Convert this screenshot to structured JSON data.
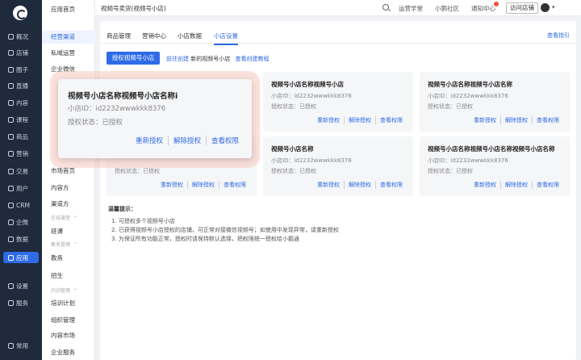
{
  "rail": {
    "items": [
      {
        "label": "概况"
      },
      {
        "label": "店铺"
      },
      {
        "label": "圈子"
      },
      {
        "label": "直播"
      },
      {
        "label": "内容"
      },
      {
        "label": "课程"
      },
      {
        "label": "商品"
      },
      {
        "label": "营销"
      },
      {
        "label": "交易"
      },
      {
        "label": "用户"
      },
      {
        "label": "CRM"
      },
      {
        "label": "企微"
      },
      {
        "label": "数据"
      },
      {
        "label": "应用"
      },
      {
        "label": "设置"
      },
      {
        "label": "服务"
      },
      {
        "label": "常用"
      }
    ],
    "active": "应用"
  },
  "submenu": {
    "home": "应用首页",
    "items": [
      "经营渠道",
      "私域运营",
      "企业微信",
      "市场首页",
      "内容方",
      "渠道方",
      "班课",
      "教务",
      "招生",
      "培训计划",
      "组织管理",
      "内容市场",
      "企业服务"
    ],
    "groups": [
      "在线课堂",
      "教务管理",
      "内训管理"
    ]
  },
  "topbar": {
    "title": "视频号卖货(视频号小店)",
    "links": [
      "运营学堂",
      "小鹅社区",
      "通知中心"
    ],
    "visit_store": "访问店铺"
  },
  "tabs": [
    "商品管理",
    "营销中心",
    "小店数据",
    "小店设置"
  ],
  "help_link": "查看指引",
  "authorize_button": "授权视频号小店",
  "create_line": {
    "link1": "前往创建",
    "text": "新的视频号小店",
    "link2": "查看创建教程"
  },
  "cards": [
    {
      "name": "视频号小店名称视频号小店",
      "id": "小店ID：id2232wwwkkk8376",
      "status": "授权状态：已授权"
    },
    {
      "name": "视频号小店名称视频号小店名称",
      "id": "小店ID：id2232wwwkkk8376",
      "status": "授权状态：已授权"
    },
    {
      "name": "视频号小店名称",
      "id": "小店ID：id2232wwwkkk8376",
      "status": "授权状态：已授权"
    },
    {
      "name": "视频号小店名称视频号小店名称视频号小店名称",
      "id": "小店ID：id2232wwwkkk8376",
      "status": "授权状态：已授权"
    },
    {
      "name": "",
      "id": "",
      "status": "授权状态：已授权"
    }
  ],
  "actions": {
    "reauth": "重新授权",
    "unauth": "解除授权",
    "view": "查看权限"
  },
  "popup": {
    "name": "视频号小店名称视频号小店名称i",
    "id": "小店ID：id2232wwwkkk8376",
    "status": "授权状态：已授权"
  },
  "tips": {
    "heading": "温馨提示：",
    "lines": [
      "1. 可授权多个视频号小店",
      "2. 已获得视频号小店授权的店铺，可正常对接微信视频号；如使用中发现异常，请重新授权",
      "3. 为保证所有功能正常，授权时请保持默认选择，把权限统一授权给小鹅通"
    ]
  }
}
